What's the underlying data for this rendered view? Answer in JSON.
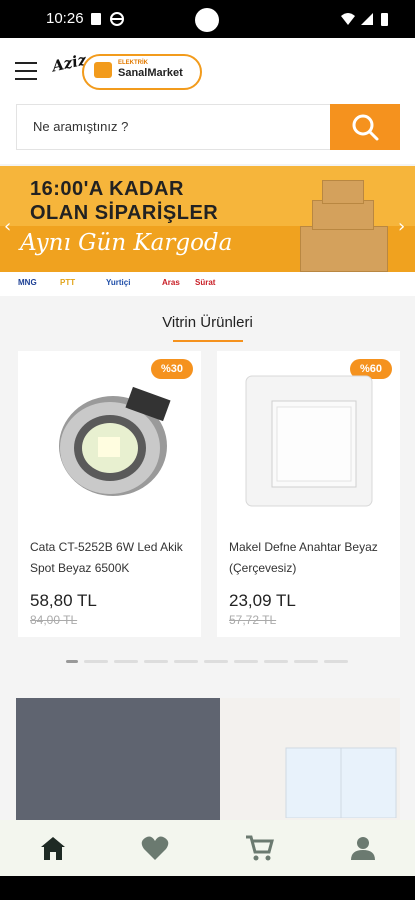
{
  "status_bar": {
    "time": "10:26"
  },
  "header": {
    "menu_icon": "hamburger-icon",
    "logo": {
      "script_text": "Aziz",
      "brand_top": "ELEKTRİK",
      "brand_name": "SanalMarket"
    }
  },
  "search": {
    "placeholder": "Ne aramıştınız ?",
    "button_icon": "search-icon"
  },
  "banner": {
    "line1": "16:00'A KADAR",
    "line2": "OLAN SİPARİŞLER",
    "line3": "Aynı Gün Kargoda",
    "carriers": [
      "MNG",
      "PTT",
      "Yurtiçi",
      "Aras",
      "Sürat"
    ]
  },
  "vitrin": {
    "title": "Vitrin Ürünleri",
    "products": [
      {
        "badge": "%30",
        "name": "Cata CT-5252B 6W Led Akik Spot Beyaz 6500K",
        "price": "58,80 TL",
        "old_price": "84,00 TL"
      },
      {
        "badge": "%60",
        "name": "Makel Defne Anahtar Beyaz (Çerçevesiz)",
        "price": "23,09 TL",
        "old_price": "57,72 TL"
      }
    ],
    "page_count": 10,
    "active_page": 1
  },
  "bottom_nav": {
    "items": [
      "home-icon",
      "heart-icon",
      "cart-icon",
      "user-icon"
    ],
    "active": "home-icon"
  },
  "colors": {
    "accent": "#f5921e",
    "banner_bg": "#f6b53b"
  }
}
